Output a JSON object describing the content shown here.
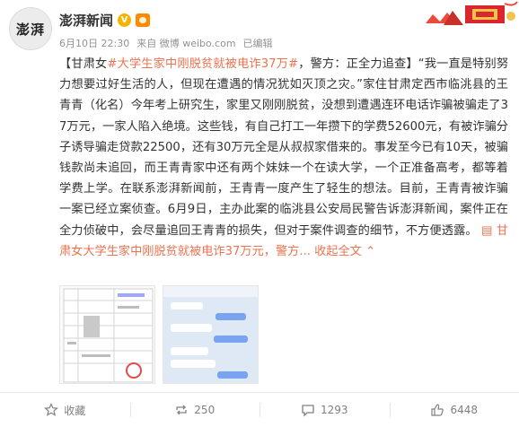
{
  "header": {
    "avatar_text": "澎湃",
    "author": "澎湃新闻",
    "meta": {
      "time": "6月10日 22:30",
      "source_prefix": "来自",
      "source": "微博 weibo.com",
      "edited": "已编辑"
    }
  },
  "post": {
    "bracket_open": "【",
    "location": "甘肃女",
    "hashtag": "#大学生家中刚脱贫就被电诈37万#",
    "intro": "，警方：正全力追查】",
    "body": "“我一直是特别努力想要过好生活的人，但现在遭遇的情况犹如灭顶之灾。”家住甘肃定西市临洮县的王青青（化名）今年考上研究生，家里又刚刚脱贫，没想到遭遇连环电话诈骗被骗走了37万元，一家人陷入绝境。这些钱，有自己打工一年攒下的学费52600元，有被诈骗分子诱导骗走贷款22500，还有30万元全是从叔叔家借来的。事发至今已有10天，被骗钱款尚未追回，而王青青家中还有两个妹妹一个在读大学，一个正准备高考，都等着学费上学。在联系澎湃新闻前，王青青一度产生了轻生的想法。目前，王青青被诈骗一案已经立案侦查。6月9日，主办此案的临洮县公安局民警告诉澎湃新闻，案件正在全力侦破中，会尽量追回王青青的损失，但对于案件调查的细节，不方便透露。",
    "link_text": "甘肃女大学生家中刚脱贫就被电诈37万元，警方...",
    "collapse_label": "收起全文"
  },
  "images": [
    {
      "alt": "表格截图"
    },
    {
      "alt": "聊天记录截图"
    }
  ],
  "actions": {
    "favorite": "收藏",
    "repost": "250",
    "comment": "1293",
    "like": "6448"
  },
  "colors": {
    "link": "#eb7350",
    "text": "#333333",
    "meta": "#939393"
  }
}
